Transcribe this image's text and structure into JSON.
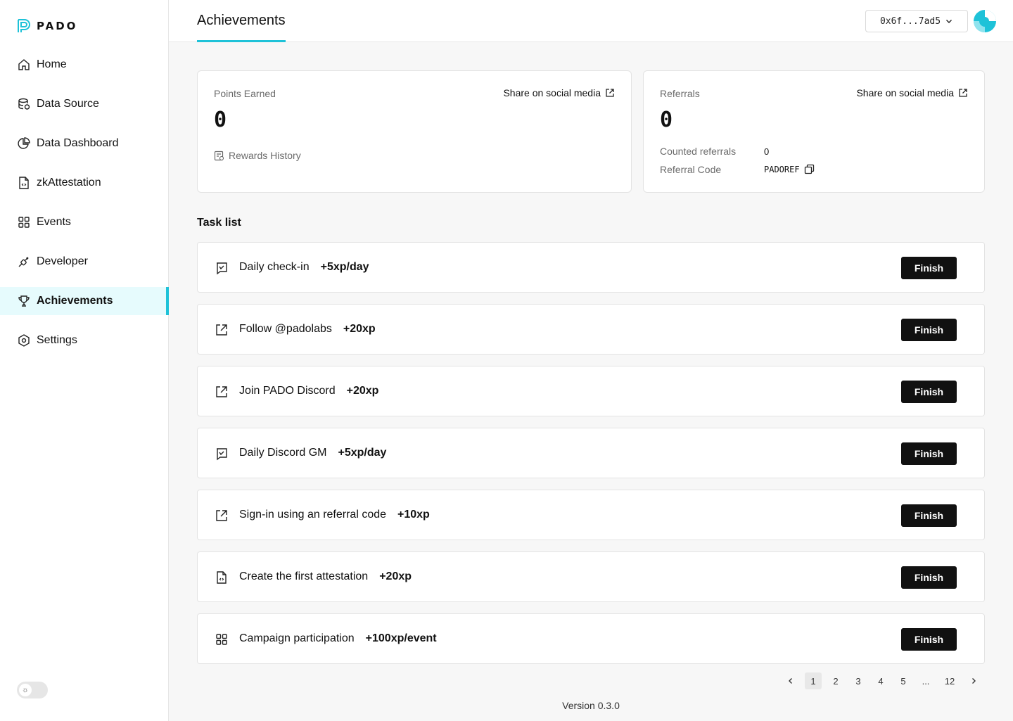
{
  "brand": {
    "name": "PADO"
  },
  "nav": {
    "items": [
      {
        "id": "home",
        "label": "Home",
        "icon": "home-icon"
      },
      {
        "id": "data-source",
        "label": "Data Source",
        "icon": "database-icon"
      },
      {
        "id": "data-dashboard",
        "label": "Data Dashboard",
        "icon": "pie-chart-icon"
      },
      {
        "id": "zkattestation",
        "label": "zkAttestation",
        "icon": "code-file-icon"
      },
      {
        "id": "events",
        "label": "Events",
        "icon": "grid-icon"
      },
      {
        "id": "developer",
        "label": "Developer",
        "icon": "plug-icon"
      },
      {
        "id": "achievements",
        "label": "Achievements",
        "icon": "trophy-icon",
        "active": true
      },
      {
        "id": "settings",
        "label": "Settings",
        "icon": "settings-icon"
      }
    ]
  },
  "header": {
    "title": "Achievements",
    "wallet": "0x6f...7ad5"
  },
  "points_card": {
    "label": "Points Earned",
    "value": "0",
    "share": "Share on social media",
    "rewards_history": "Rewards History"
  },
  "referrals_card": {
    "label": "Referrals",
    "value": "0",
    "share": "Share on social media",
    "counted_label": "Counted referrals",
    "counted_value": "0",
    "code_label": "Referral Code",
    "code_value": "PADOREF"
  },
  "tasks": {
    "title": "Task list",
    "finish_label": "Finish",
    "items": [
      {
        "name": "Daily check-in",
        "xp": "+5xp/day",
        "icon": "checkin-icon"
      },
      {
        "name": "Follow @padolabs",
        "xp": "+20xp",
        "icon": "external-link-icon"
      },
      {
        "name": "Join PADO Discord",
        "xp": "+20xp",
        "icon": "external-link-icon"
      },
      {
        "name": "Daily Discord GM",
        "xp": "+5xp/day",
        "icon": "checkin-icon"
      },
      {
        "name": "Sign-in using an referral code",
        "xp": "+10xp",
        "icon": "external-link-icon"
      },
      {
        "name": "Create the first attestation",
        "xp": "+20xp",
        "icon": "code-file-icon"
      },
      {
        "name": "Campaign participation",
        "xp": "+100xp/event",
        "icon": "grid-icon"
      }
    ]
  },
  "pagination": {
    "pages": [
      "1",
      "2",
      "3",
      "4",
      "5",
      "...",
      "12"
    ],
    "current": "1"
  },
  "footer": {
    "version": "Version 0.3.0"
  },
  "colors": {
    "accent": "#1ec2d8",
    "active_bg": "#e6fbfd",
    "button": "#111111"
  }
}
